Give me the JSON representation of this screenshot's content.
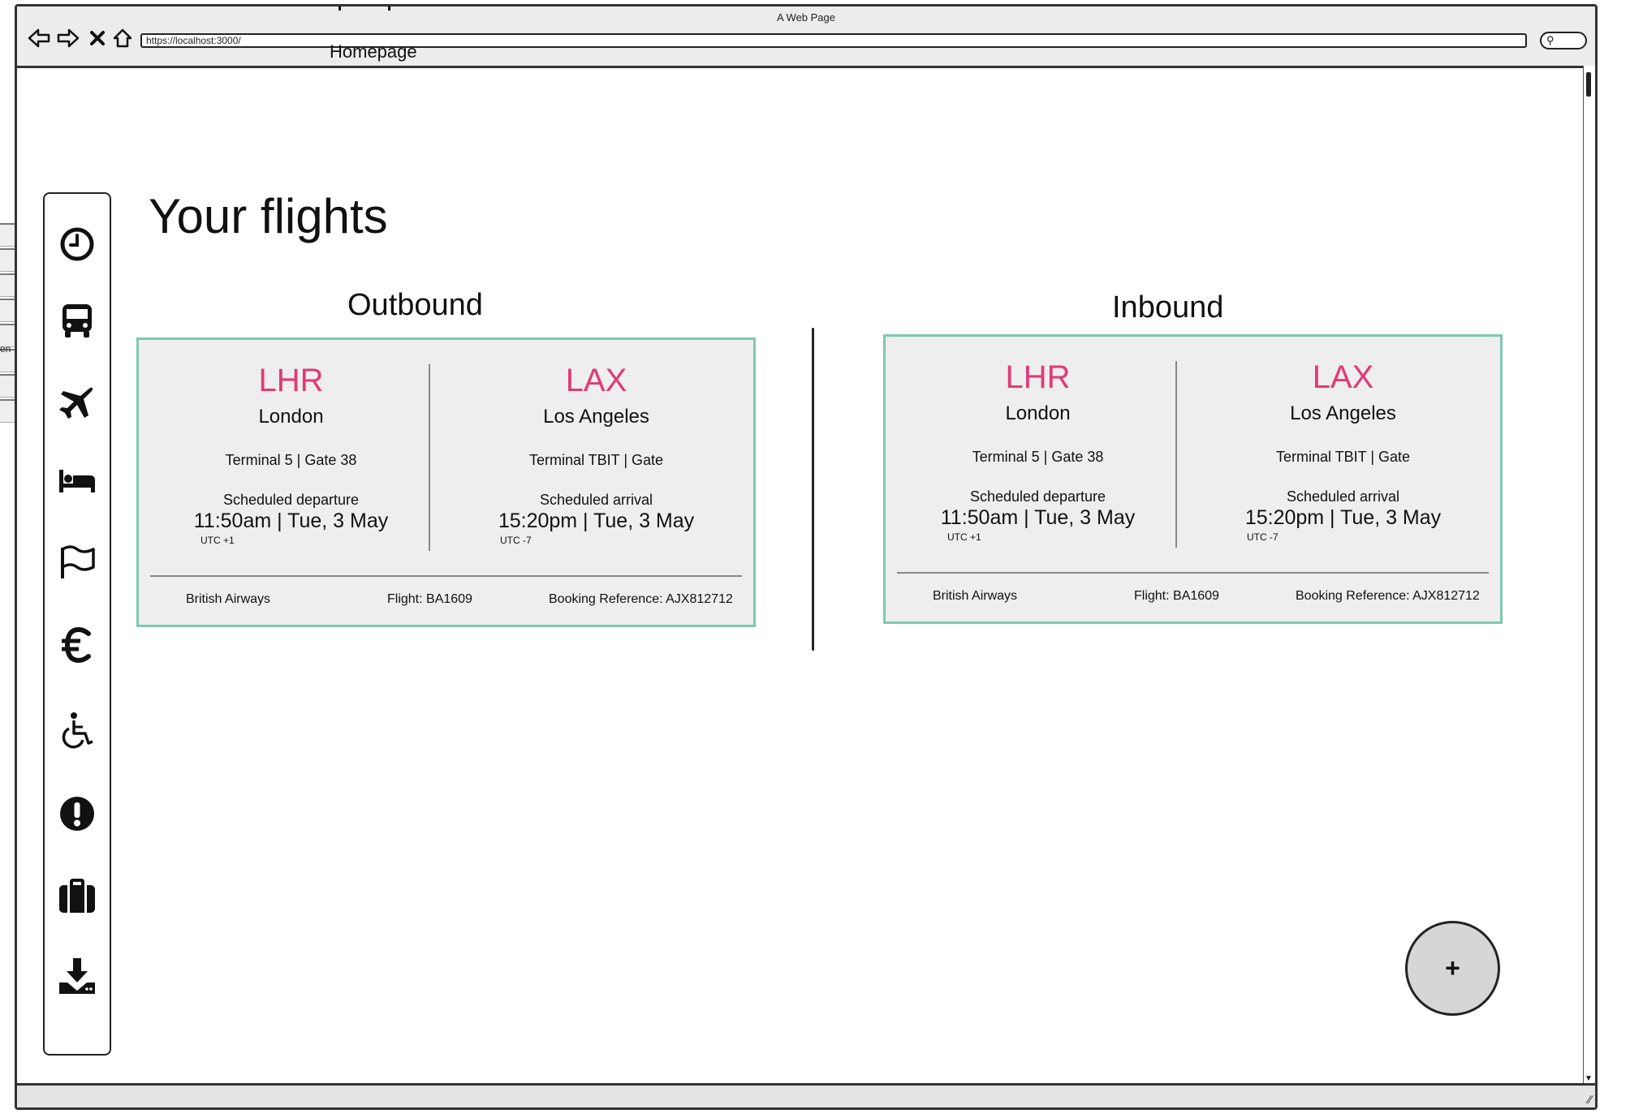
{
  "window": {
    "title": "A Web Page",
    "url": "https://localhost:3000/",
    "tab_label": "Homepage"
  },
  "left_strip": {
    "partial_text": "en"
  },
  "sidebar": {
    "items": [
      {
        "icon": "clock-icon"
      },
      {
        "icon": "bus-icon"
      },
      {
        "icon": "plane-icon"
      },
      {
        "icon": "bed-icon"
      },
      {
        "icon": "flag-icon"
      },
      {
        "icon": "euro-icon"
      },
      {
        "icon": "wheelchair-icon"
      },
      {
        "icon": "alert-icon"
      },
      {
        "icon": "briefcase-icon"
      },
      {
        "icon": "download-icon"
      }
    ]
  },
  "page": {
    "title": "Your flights"
  },
  "outbound": {
    "heading": "Outbound",
    "from": {
      "code": "LHR",
      "city": "London",
      "terminal": "Terminal 5 | Gate 38",
      "sched_label": "Scheduled departure",
      "time": "11:50am | Tue, 3 May",
      "utc": "UTC +1"
    },
    "to": {
      "code": "LAX",
      "city": "Los Angeles",
      "terminal": "Terminal TBIT | Gate",
      "sched_label": "Scheduled arrival",
      "time": "15:20pm | Tue, 3 May",
      "utc": "UTC -7"
    },
    "airline": "British Airways",
    "flight": "Flight: BA1609",
    "booking": "Booking Reference: AJX812712"
  },
  "inbound": {
    "heading": "Inbound",
    "from": {
      "code": "LHR",
      "city": "London",
      "terminal": "Terminal 5 | Gate 38",
      "sched_label": "Scheduled departure",
      "time": "11:50am | Tue, 3 May",
      "utc": "UTC +1"
    },
    "to": {
      "code": "LAX",
      "city": "Los Angeles",
      "terminal": "Terminal TBIT | Gate",
      "sched_label": "Scheduled arrival",
      "time": "15:20pm | Tue, 3 May",
      "utc": "UTC -7"
    },
    "airline": "British Airways",
    "flight": "Flight: BA1609",
    "booking": "Booking Reference: AJX812712"
  },
  "fab": {
    "label": "+"
  },
  "colors": {
    "accent": "#e03a76",
    "card_border": "#7ec8b2",
    "card_bg": "#eeeeee"
  }
}
